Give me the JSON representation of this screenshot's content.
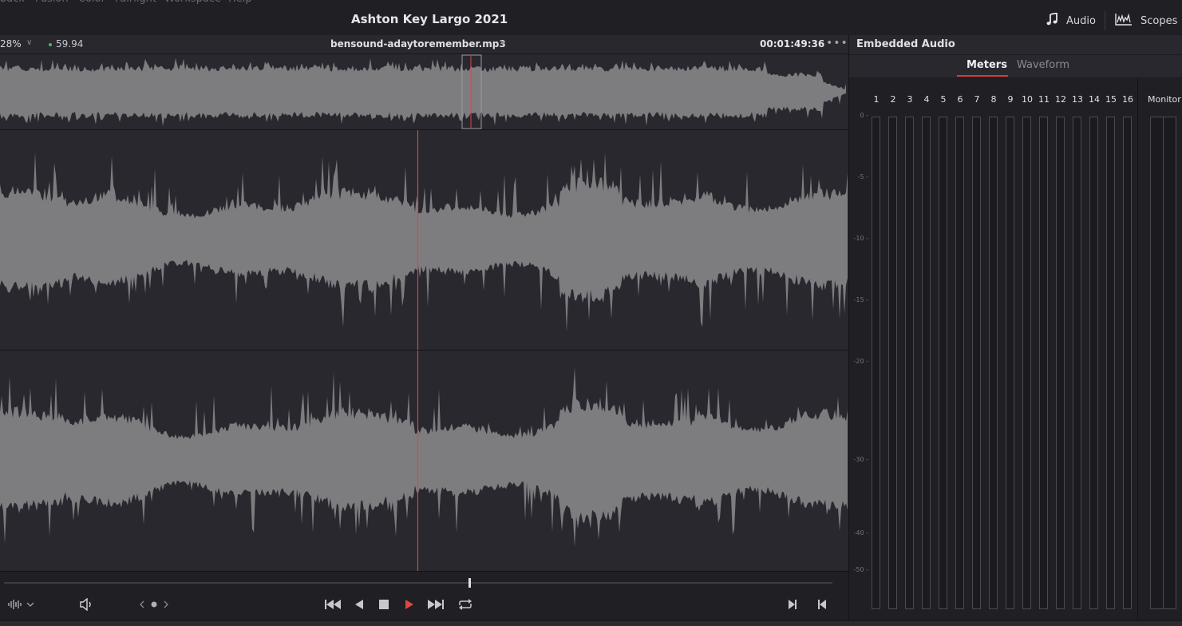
{
  "menu": {
    "items": [
      "back",
      "Fusion",
      "Color",
      "Fairlight",
      "Workspace",
      "Help"
    ]
  },
  "title_bar": {
    "project_title": "Ashton Key Largo 2021",
    "audio_label": "Audio",
    "scopes_label": "Scopes",
    "audio_icon": "music-note-icon",
    "scopes_icon": "scopes-waveform-icon"
  },
  "viewer": {
    "zoom": "28%",
    "fps": "59.94",
    "clip_name": "bensound-adaytoremember.mp3",
    "timecode": "00:01:49:36",
    "more_label": "•••"
  },
  "colors": {
    "playhead": "#d84848",
    "waveform": "#7d7d80",
    "background": "#28282e",
    "accent_tab": "#d83a3a",
    "status_dot": "#3fbf5f"
  },
  "transport": {
    "play_icon": "play-icon",
    "stop_icon": "stop-icon",
    "loop_icon": "loop-icon",
    "scrub_position": 0.566
  },
  "audio_panel": {
    "title": "Embedded Audio",
    "tabs": [
      {
        "label": "Meters",
        "active": true
      },
      {
        "label": "Waveform",
        "active": false
      }
    ],
    "channels": [
      "1",
      "2",
      "3",
      "4",
      "5",
      "6",
      "7",
      "8",
      "9",
      "10",
      "11",
      "12",
      "13",
      "14",
      "15",
      "16"
    ],
    "monitor_label": "Monitor",
    "scale": [
      "0",
      "-5",
      "-10",
      "-15",
      "-20",
      "-30",
      "-40",
      "-50"
    ]
  }
}
